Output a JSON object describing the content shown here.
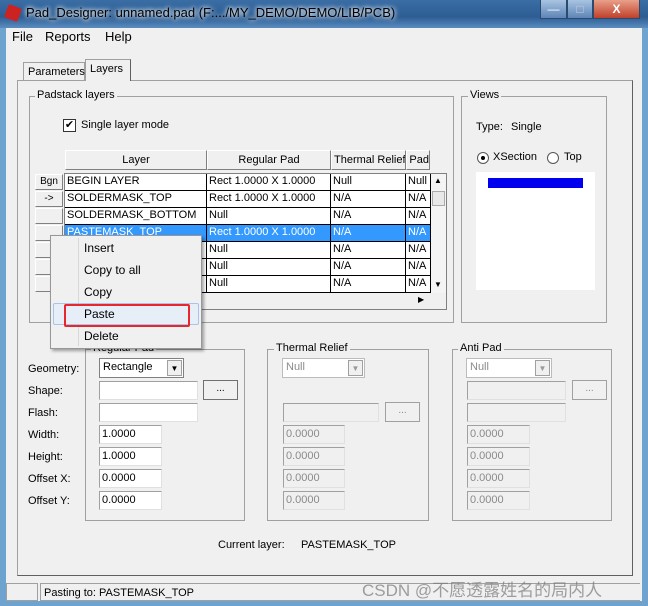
{
  "window": {
    "title": "Pad_Designer: unnamed.pad (F:.../MY_DEMO/DEMO/LIB/PCB)",
    "minimize": "—",
    "maximize": "□",
    "close": "X"
  },
  "menu": [
    "File",
    "Reports",
    "Help"
  ],
  "tabs": [
    {
      "label": "Parameters",
      "active": false
    },
    {
      "label": "Layers",
      "active": true
    }
  ],
  "padstack": {
    "group_label": "Padstack layers",
    "single_layer_mode": {
      "label": "Single layer mode",
      "checked": true
    },
    "columns": [
      "Layer",
      "Regular Pad",
      "Thermal Relief",
      "Anti Pad"
    ],
    "row_buttons": [
      "Bgn",
      "->",
      "",
      "",
      "",
      "",
      ""
    ],
    "rows": [
      [
        "BEGIN LAYER",
        "Rect 1.0000 X 1.0000",
        "Null",
        "Null"
      ],
      [
        "SOLDERMASK_TOP",
        "Rect 1.0000 X 1.0000",
        "N/A",
        "N/A"
      ],
      [
        "SOLDERMASK_BOTTOM",
        "Null",
        "N/A",
        "N/A"
      ],
      [
        "PASTEMASK_TOP",
        "Rect 1.0000 X 1.0000",
        "N/A",
        "N/A"
      ],
      [
        "",
        "Null",
        "N/A",
        "N/A"
      ],
      [
        "",
        "Null",
        "N/A",
        "N/A"
      ],
      [
        "",
        "Null",
        "N/A",
        "N/A"
      ]
    ],
    "selected_row": 3
  },
  "context_menu": {
    "items": [
      "Insert",
      "Copy to all",
      "Copy",
      "Paste",
      "Delete"
    ],
    "highlighted": "Paste",
    "highlight_color": "#e8262b"
  },
  "views": {
    "group_label": "Views",
    "type_label": "Type:",
    "type_value": "Single",
    "xsection_label": "XSection",
    "top_label": "Top",
    "selected": "XSection",
    "bar_color": "#0000ee"
  },
  "fields": {
    "geometry": "Geometry:",
    "shape": "Shape:",
    "flash": "Flash:",
    "width": "Width:",
    "height": "Height:",
    "offset_x": "Offset X:",
    "offset_y": "Offset Y:"
  },
  "regular_pad": {
    "label": "Regular Pad",
    "geometry": "Rectangle",
    "shape": "",
    "flash": "",
    "width": "1.0000",
    "height": "1.0000",
    "offset_x": "0.0000",
    "offset_y": "0.0000",
    "browse": "..."
  },
  "thermal_relief": {
    "label": "Thermal Relief",
    "geometry": "Null",
    "flash": "",
    "width": "0.0000",
    "height": "0.0000",
    "offset_x": "0.0000",
    "offset_y": "0.0000",
    "browse": "..."
  },
  "anti_pad": {
    "label": "Anti Pad",
    "geometry": "Null",
    "shape": "",
    "flash": "",
    "width": "0.0000",
    "height": "0.0000",
    "offset_x": "0.0000",
    "offset_y": "0.0000",
    "browse": "..."
  },
  "current_layer": {
    "label": "Current layer:",
    "value": "PASTEMASK_TOP"
  },
  "status": {
    "text": "Pasting to: PASTEMASK_TOP"
  },
  "watermark": "CSDN @不愿透露姓名的局内人"
}
